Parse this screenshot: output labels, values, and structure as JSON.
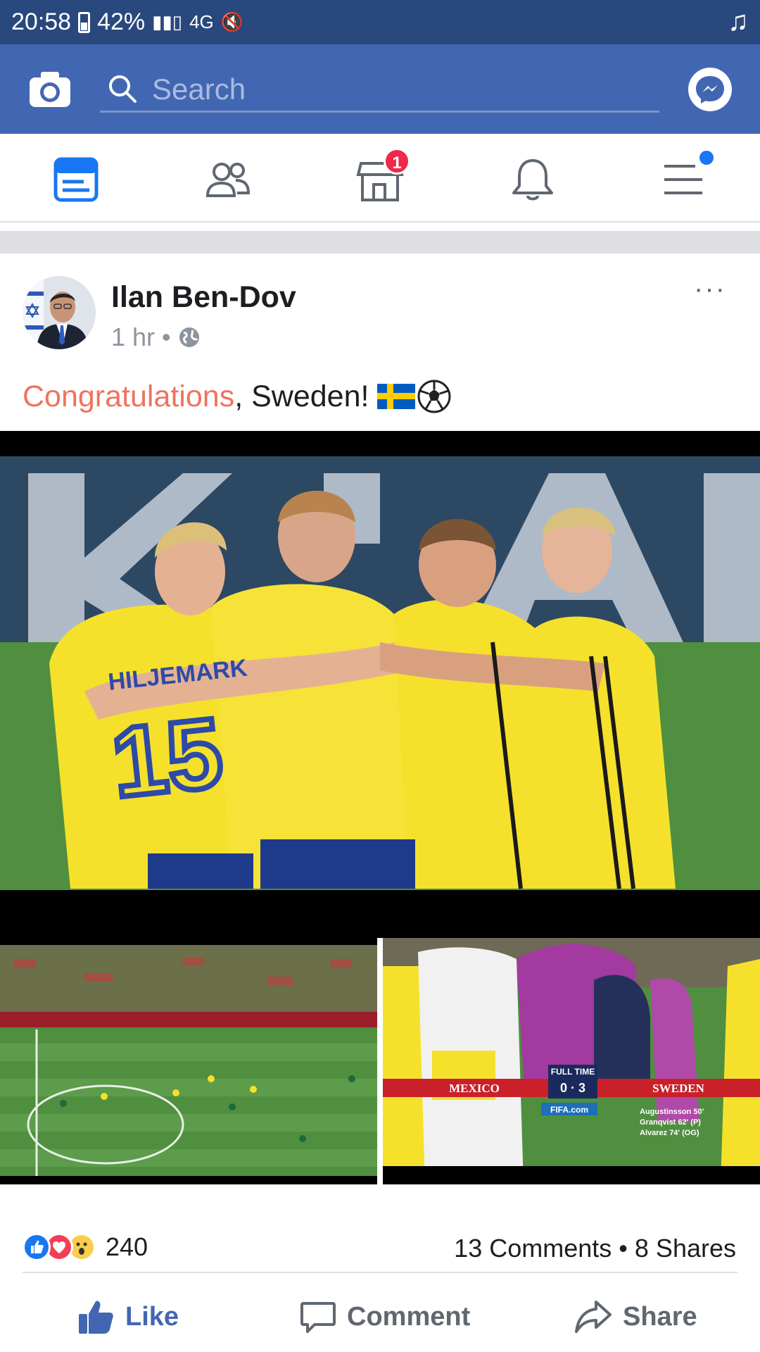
{
  "status_bar": {
    "time": "20:58",
    "battery": "42%",
    "network": "4G"
  },
  "search": {
    "placeholder": "Search"
  },
  "nav": {
    "items": [
      "news-feed",
      "friends",
      "marketplace",
      "notifications",
      "menu"
    ],
    "marketplace_badge": "1"
  },
  "post": {
    "author": "Ilan Ben-Dov",
    "time": "1 hr",
    "separator": "•",
    "text_highlight": "Congratulations",
    "text_rest": ", Sweden!",
    "more": "···",
    "scoreboard": {
      "label": "FULL TIME",
      "home": "MEXICO",
      "score": "0 · 3",
      "away": "SWEDEN",
      "sponsor": "FIFA.com",
      "scorers": [
        "Augustinsson 50'",
        "Granqvist 62' (P)",
        "Alvarez 74' (OG)"
      ]
    },
    "jersey_name": "HILJEMARK",
    "jersey_number": "15",
    "reactions_count": "240",
    "comments": "13 Comments",
    "stat_sep": "•",
    "shares": "8 Shares",
    "actions": {
      "like": "Like",
      "comment": "Comment",
      "share": "Share"
    }
  },
  "colors": {
    "status_bar": "#29487d",
    "topbar": "#4267b2",
    "highlight": "#f0735f",
    "badge": "#f02849",
    "swedish_yellow": "#f5e12b",
    "pitch": "#4f8f3f"
  }
}
